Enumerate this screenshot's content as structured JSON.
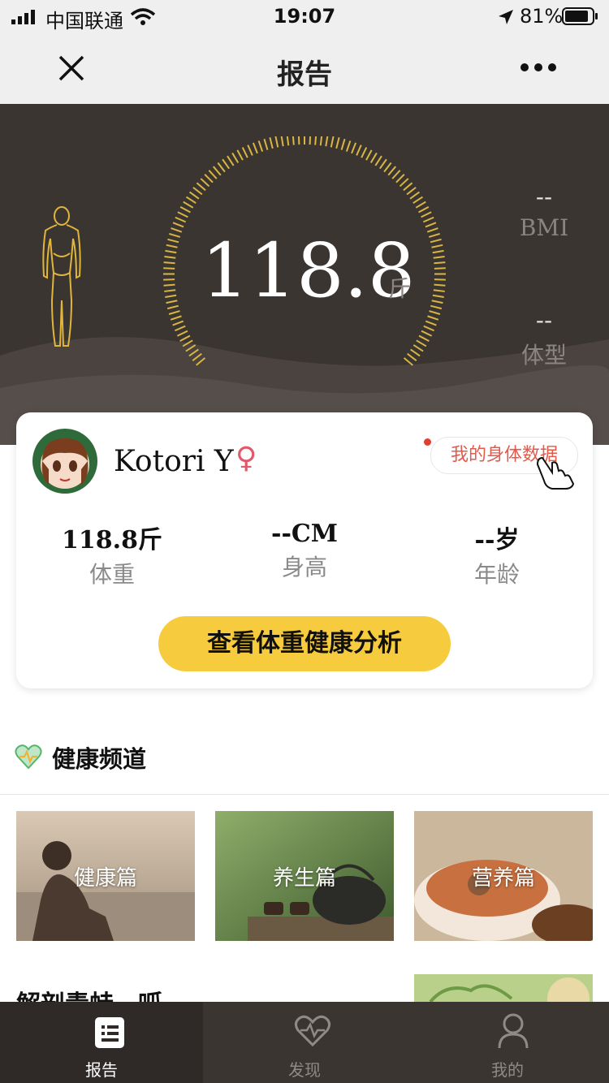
{
  "status_bar": {
    "carrier": "中国联通",
    "time": "19:07",
    "battery": "81%"
  },
  "nav": {
    "title": "报告"
  },
  "hero": {
    "weight": "118.8",
    "unit": "斤",
    "bmi_value": "--",
    "bmi_label": "BMI",
    "body_type_value": "--",
    "body_type_label": "体型"
  },
  "profile": {
    "name": "Kotori Y",
    "gender_symbol": "♀",
    "my_data_button": "我的身体数据",
    "stats": [
      {
        "value": "118.8斤",
        "label": "体重"
      },
      {
        "value": "--CM",
        "label": "身高"
      },
      {
        "value": "--岁",
        "label": "年龄"
      }
    ],
    "cta": "查看体重健康分析"
  },
  "health_channel": {
    "title": "健康频道",
    "tiles": [
      {
        "label": "健康篇"
      },
      {
        "label": "养生篇"
      },
      {
        "label": "营养篇"
      }
    ],
    "article_title": "解剖青蛙，呱"
  },
  "tabbar": {
    "items": [
      {
        "label": "报告",
        "icon": "report-icon",
        "active": true
      },
      {
        "label": "发现",
        "icon": "heart-icon",
        "active": false
      },
      {
        "label": "我的",
        "icon": "person-icon",
        "active": false
      }
    ]
  },
  "colors": {
    "accent": "#f7cb3e",
    "dark_bg": "#3b3532",
    "red": "#e25a4a"
  }
}
